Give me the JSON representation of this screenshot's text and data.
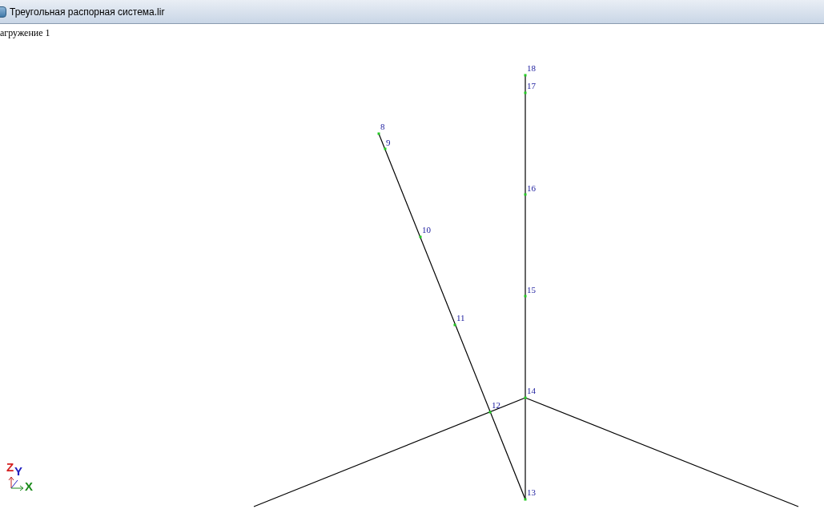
{
  "window": {
    "title": "Треугольная распорная система.lir"
  },
  "load_case": "агружение 1",
  "nodes": [
    {
      "label": "18"
    },
    {
      "label": "17"
    },
    {
      "label": "8"
    },
    {
      "label": "9"
    },
    {
      "label": "16"
    },
    {
      "label": "10"
    },
    {
      "label": "15"
    },
    {
      "label": "11"
    },
    {
      "label": "14"
    },
    {
      "label": "12"
    },
    {
      "label": "13"
    }
  ],
  "axes": [
    {
      "label": "Z",
      "color": "#d42020"
    },
    {
      "label": "Y",
      "color": "#2020c0"
    },
    {
      "label": "X",
      "color": "#1a8a1a"
    }
  ]
}
